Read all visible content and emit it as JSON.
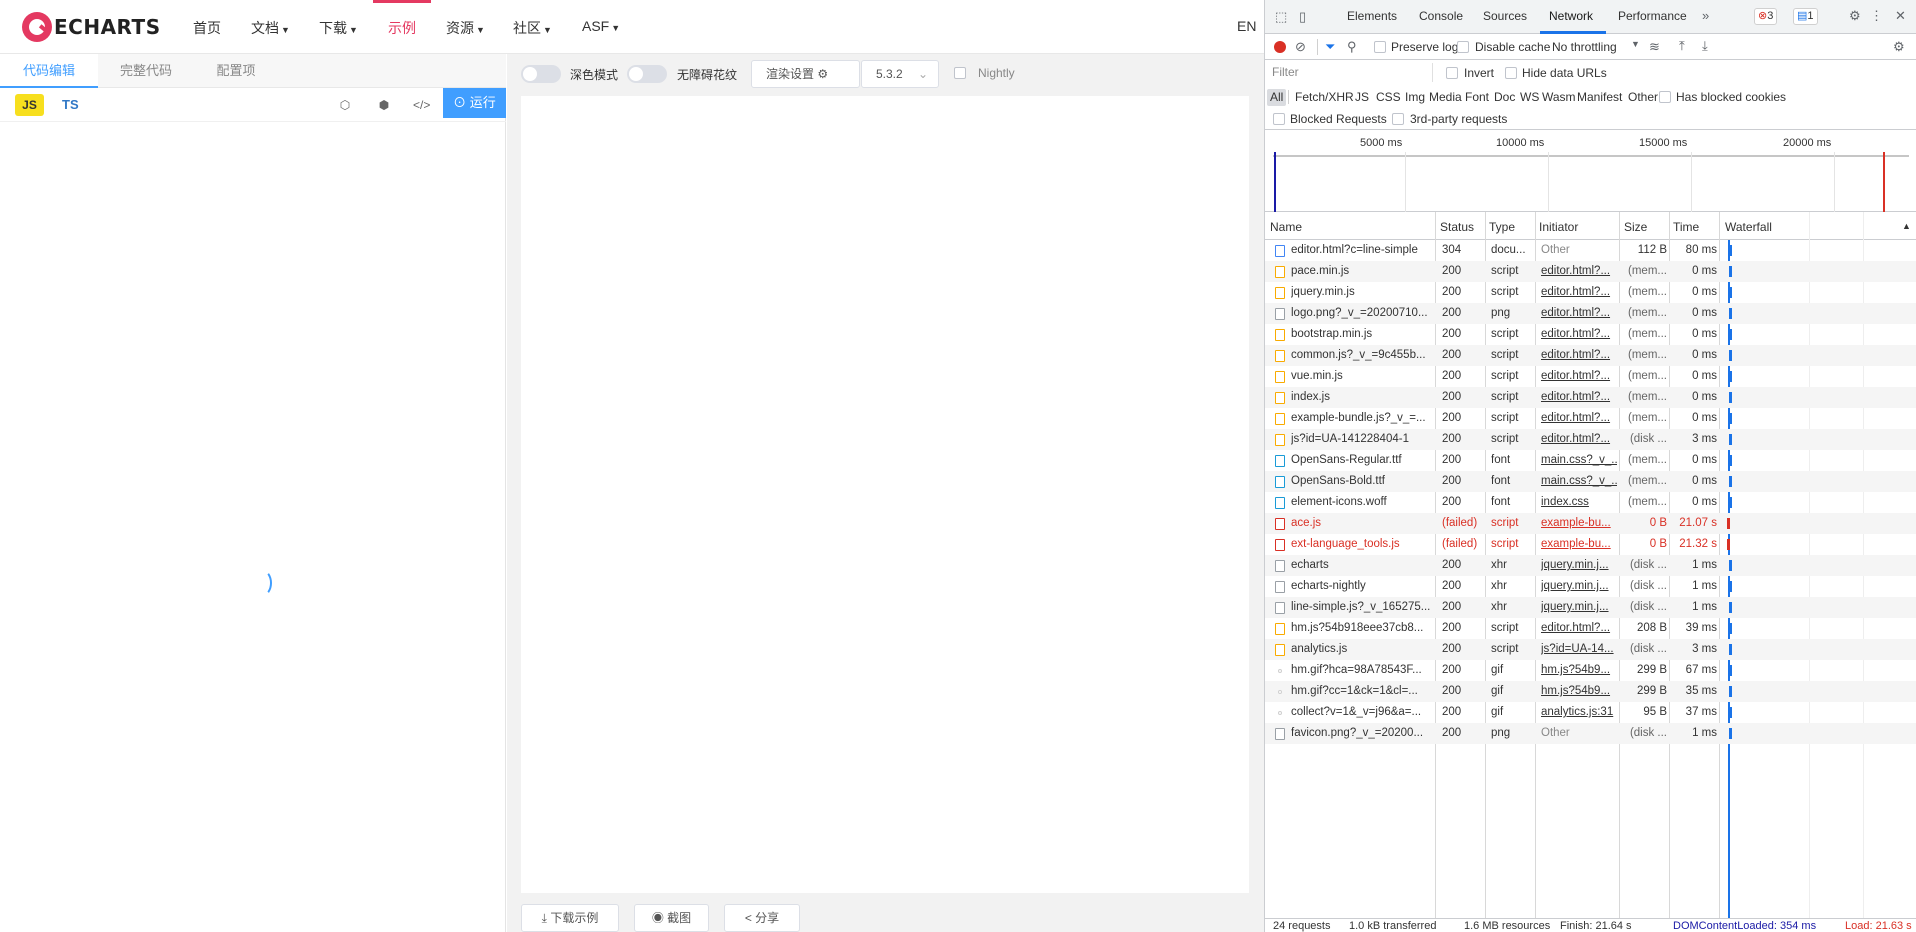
{
  "nav": {
    "logo_text": "ECHARTS",
    "items": [
      "首页",
      "文档",
      "下载",
      "示例",
      "资源",
      "社区",
      "ASF"
    ],
    "active": "示例",
    "lang": "EN"
  },
  "editor": {
    "tabs": [
      "代码编辑",
      "完整代码",
      "配置项"
    ],
    "lang_js": "JS",
    "lang_ts": "TS",
    "run_label": "运行"
  },
  "options": {
    "dark_mode": "深色模式",
    "no_barrier": "无障碍花纹",
    "render_settings": "渲染设置",
    "version": "5.3.2",
    "nightly": "Nightly"
  },
  "bottom": {
    "download": "下载示例",
    "screenshot": "截图",
    "share": "分享"
  },
  "devtools": {
    "tabs": [
      "Elements",
      "Console",
      "Sources",
      "Network",
      "Performance"
    ],
    "active_tab": "Network",
    "error_count": "3",
    "message_count": "1",
    "preserve_log": "Preserve log",
    "disable_cache": "Disable cache",
    "throttling": "No throttling",
    "filter_placeholder": "Filter",
    "invert": "Invert",
    "hide_data_urls": "Hide data URLs",
    "types": [
      "All",
      "Fetch/XHR",
      "JS",
      "CSS",
      "Img",
      "Media",
      "Font",
      "Doc",
      "WS",
      "Wasm",
      "Manifest",
      "Other"
    ],
    "has_blocked_cookies": "Has blocked cookies",
    "blocked_requests": "Blocked Requests",
    "third_party": "3rd-party requests",
    "overview_ticks": [
      "5000 ms",
      "10000 ms",
      "15000 ms",
      "20000 ms"
    ],
    "columns": [
      "Name",
      "Status",
      "Type",
      "Initiator",
      "Size",
      "Time",
      "Waterfall"
    ],
    "requests": [
      {
        "name": "editor.html?c=line-simple",
        "status": "304",
        "type": "docu...",
        "initiator": "Other",
        "size": "112 B",
        "time": "80 ms",
        "icon": "doc",
        "failed": false
      },
      {
        "name": "pace.min.js",
        "status": "200",
        "type": "script",
        "initiator": "editor.html?...",
        "size": "(mem...",
        "time": "0 ms",
        "icon": "script",
        "failed": false
      },
      {
        "name": "jquery.min.js",
        "status": "200",
        "type": "script",
        "initiator": "editor.html?...",
        "size": "(mem...",
        "time": "0 ms",
        "icon": "script",
        "failed": false
      },
      {
        "name": "logo.png?_v_=20200710...",
        "status": "200",
        "type": "png",
        "initiator": "editor.html?...",
        "size": "(mem...",
        "time": "0 ms",
        "icon": "img",
        "failed": false
      },
      {
        "name": "bootstrap.min.js",
        "status": "200",
        "type": "script",
        "initiator": "editor.html?...",
        "size": "(mem...",
        "time": "0 ms",
        "icon": "script",
        "failed": false
      },
      {
        "name": "common.js?_v_=9c455b...",
        "status": "200",
        "type": "script",
        "initiator": "editor.html?...",
        "size": "(mem...",
        "time": "0 ms",
        "icon": "script",
        "failed": false
      },
      {
        "name": "vue.min.js",
        "status": "200",
        "type": "script",
        "initiator": "editor.html?...",
        "size": "(mem...",
        "time": "0 ms",
        "icon": "script",
        "failed": false
      },
      {
        "name": "index.js",
        "status": "200",
        "type": "script",
        "initiator": "editor.html?...",
        "size": "(mem...",
        "time": "0 ms",
        "icon": "script",
        "failed": false
      },
      {
        "name": "example-bundle.js?_v_=...",
        "status": "200",
        "type": "script",
        "initiator": "editor.html?...",
        "size": "(mem...",
        "time": "0 ms",
        "icon": "script",
        "failed": false
      },
      {
        "name": "js?id=UA-141228404-1",
        "status": "200",
        "type": "script",
        "initiator": "editor.html?...",
        "size": "(disk ...",
        "time": "3 ms",
        "icon": "script",
        "failed": false
      },
      {
        "name": "OpenSans-Regular.ttf",
        "status": "200",
        "type": "font",
        "initiator": "main.css?_v_...",
        "size": "(mem...",
        "time": "0 ms",
        "icon": "font",
        "failed": false
      },
      {
        "name": "OpenSans-Bold.ttf",
        "status": "200",
        "type": "font",
        "initiator": "main.css?_v_...",
        "size": "(mem...",
        "time": "0 ms",
        "icon": "font",
        "failed": false
      },
      {
        "name": "element-icons.woff",
        "status": "200",
        "type": "font",
        "initiator": "index.css",
        "size": "(mem...",
        "time": "0 ms",
        "icon": "font",
        "failed": false
      },
      {
        "name": "ace.js",
        "status": "(failed)",
        "type": "script",
        "initiator": "example-bu...",
        "size": "0 B",
        "time": "21.07 s",
        "icon": "error",
        "failed": true
      },
      {
        "name": "ext-language_tools.js",
        "status": "(failed)",
        "type": "script",
        "initiator": "example-bu...",
        "size": "0 B",
        "time": "21.32 s",
        "icon": "error",
        "failed": true
      },
      {
        "name": "echarts",
        "status": "200",
        "type": "xhr",
        "initiator": "jquery.min.j...",
        "size": "(disk ...",
        "time": "1 ms",
        "icon": "xhr",
        "failed": false
      },
      {
        "name": "echarts-nightly",
        "status": "200",
        "type": "xhr",
        "initiator": "jquery.min.j...",
        "size": "(disk ...",
        "time": "1 ms",
        "icon": "xhr",
        "failed": false
      },
      {
        "name": "line-simple.js?_v_165275...",
        "status": "200",
        "type": "xhr",
        "initiator": "jquery.min.j...",
        "size": "(disk ...",
        "time": "1 ms",
        "icon": "xhr",
        "failed": false
      },
      {
        "name": "hm.js?54b918eee37cb8...",
        "status": "200",
        "type": "script",
        "initiator": "editor.html?...",
        "size": "208 B",
        "time": "39 ms",
        "icon": "script",
        "failed": false
      },
      {
        "name": "analytics.js",
        "status": "200",
        "type": "script",
        "initiator": "js?id=UA-14...",
        "size": "(disk ...",
        "time": "3 ms",
        "icon": "script",
        "failed": false
      },
      {
        "name": "hm.gif?hca=98A78543F...",
        "status": "200",
        "type": "gif",
        "initiator": "hm.js?54b9...",
        "size": "299 B",
        "time": "67 ms",
        "icon": "dot",
        "failed": false
      },
      {
        "name": "hm.gif?cc=1&ck=1&cl=...",
        "status": "200",
        "type": "gif",
        "initiator": "hm.js?54b9...",
        "size": "299 B",
        "time": "35 ms",
        "icon": "dot",
        "failed": false
      },
      {
        "name": "collect?v=1&_v=j96&a=...",
        "status": "200",
        "type": "gif",
        "initiator": "analytics.js:31",
        "size": "95 B",
        "time": "37 ms",
        "icon": "dot",
        "failed": false
      },
      {
        "name": "favicon.png?_v_=20200...",
        "status": "200",
        "type": "png",
        "initiator": "Other",
        "size": "(disk ...",
        "time": "1 ms",
        "icon": "xhr",
        "failed": false
      }
    ],
    "status_bar": {
      "requests": "24 requests",
      "transferred": "1.0 kB transferred",
      "resources": "1.6 MB resources",
      "finish": "Finish: 21.64 s",
      "dom_loaded": "DOMContentLoaded: 354 ms",
      "load": "Load: 21.63 s"
    },
    "colors": {
      "accent": "#1a73e8",
      "error": "#d93025",
      "dom_loaded": "#1a1aa6"
    }
  }
}
